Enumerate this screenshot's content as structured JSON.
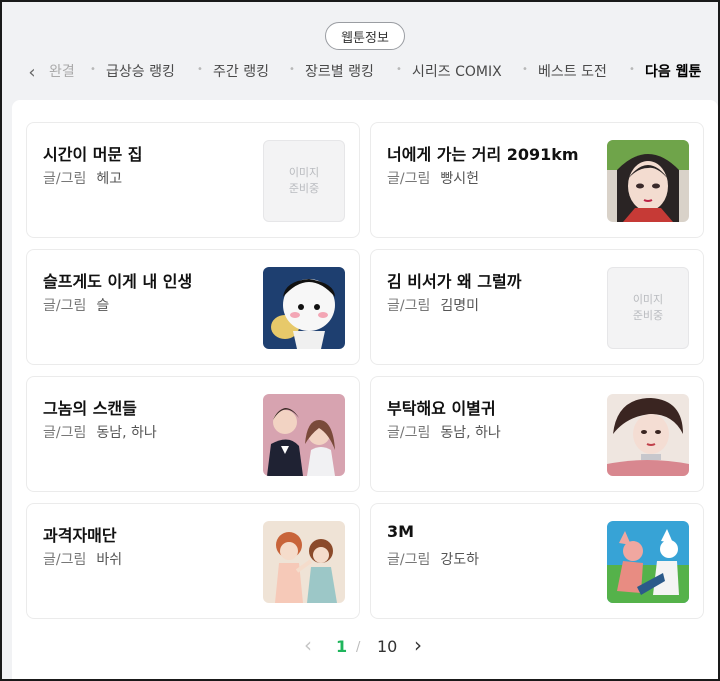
{
  "header": {
    "badge": "웹툰정보",
    "nav": [
      {
        "label": "완결",
        "state": "fade"
      },
      {
        "label": "급상승 랭킹",
        "state": "normal"
      },
      {
        "label": "주간 랭킹",
        "state": "normal"
      },
      {
        "label": "장르별 랭킹",
        "state": "normal"
      },
      {
        "label": "시리즈 COMIX",
        "state": "normal"
      },
      {
        "label": "베스트 도전",
        "state": "normal"
      },
      {
        "label": "다음 웹툰",
        "state": "active"
      }
    ]
  },
  "cards": [
    {
      "title": "시간이 머문 집",
      "meta_label": "글/그림",
      "author": "헤고",
      "image": "placeholder"
    },
    {
      "title": "너에게 가는 거리 2091km",
      "meta_label": "글/그림",
      "author": "빵시헌",
      "image": "illustration"
    },
    {
      "title": "슬프게도 이게 내 인생",
      "meta_label": "글/그림",
      "author": "슬",
      "image": "illustration"
    },
    {
      "title": "김 비서가 왜 그럴까",
      "meta_label": "글/그림",
      "author": "김명미",
      "image": "placeholder"
    },
    {
      "title": "그놈의 스캔들",
      "meta_label": "글/그림",
      "author": "동남, 하나",
      "image": "illustration"
    },
    {
      "title": "부탁해요 이별귀",
      "meta_label": "글/그림",
      "author": "동남, 하나",
      "image": "illustration"
    },
    {
      "title": "과격자매단",
      "meta_label": "글/그림",
      "author": "바쉬",
      "image": "illustration"
    },
    {
      "title": "3M",
      "meta_label": "글/그림",
      "author": "강도하",
      "image": "illustration"
    }
  ],
  "placeholder_text": {
    "line1": "이미지",
    "line2": "준비중"
  },
  "pagination": {
    "current": "1",
    "separator": "/",
    "total": "10"
  },
  "colors": {
    "accent_green": "#1fb55c",
    "bg": "#f1f2f4"
  }
}
